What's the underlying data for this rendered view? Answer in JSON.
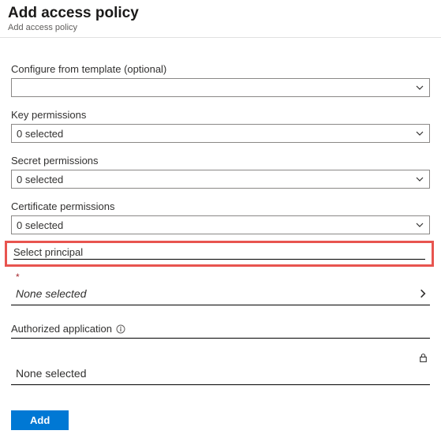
{
  "header": {
    "title": "Add access policy",
    "subtitle": "Add access policy"
  },
  "fields": {
    "template": {
      "label": "Configure from template (optional)",
      "value": ""
    },
    "key_permissions": {
      "label": "Key permissions",
      "value": "0 selected"
    },
    "secret_permissions": {
      "label": "Secret permissions",
      "value": "0 selected"
    },
    "certificate_permissions": {
      "label": "Certificate permissions",
      "value": "0 selected"
    },
    "select_principal": {
      "label": "Select principal",
      "required_marker": "*",
      "value": "None selected"
    },
    "authorized_application": {
      "label": "Authorized application",
      "value": "None selected"
    }
  },
  "buttons": {
    "add": "Add"
  }
}
